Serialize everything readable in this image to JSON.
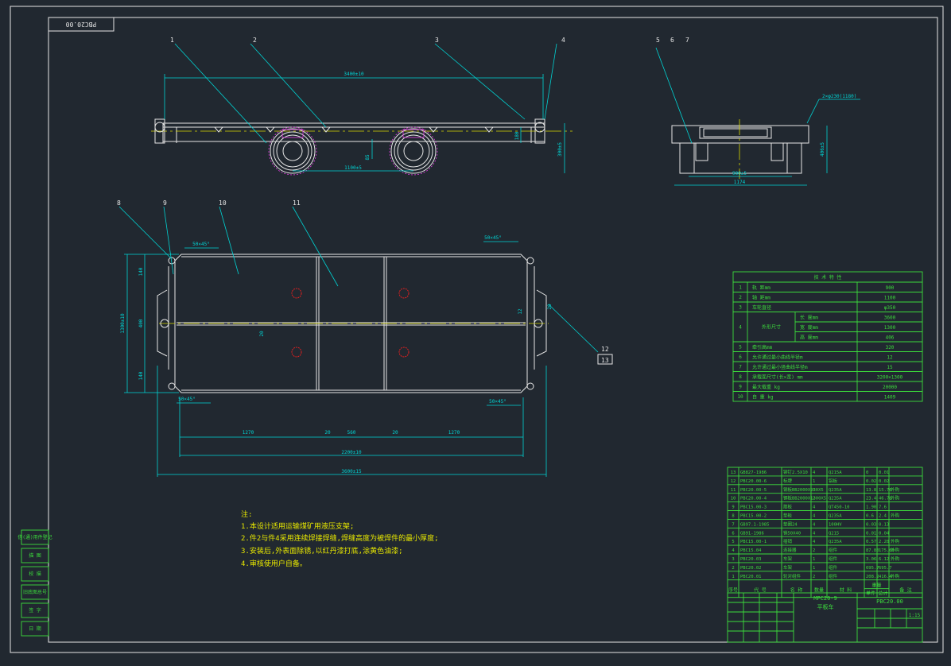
{
  "drawing_code_box": "PBC20.00",
  "balloons_top": [
    "1",
    "2",
    "3",
    "4"
  ],
  "balloons_side": [
    "5",
    "6",
    "7"
  ],
  "balloons_plan": [
    "8",
    "9",
    "10",
    "11"
  ],
  "balloons_right": [
    "12",
    "13"
  ],
  "dims": {
    "top_len": "3400±10",
    "wheelbase": "1100±5",
    "height": "300±5",
    "h_small": "180",
    "offset": "85",
    "side_note": "2×φ230(1180)",
    "side_height": "406±5",
    "side_gauge": "900±5",
    "side_width": "1174",
    "corner_tl": "50×45°",
    "corner_tr": "50×45°",
    "corner_bl": "50×45°",
    "corner_br": "50×45°",
    "plan_seg1": "1270",
    "plan_seg2": "20",
    "plan_seg3": "560",
    "plan_seg4": "20",
    "plan_seg5": "1270",
    "plan_inner": "2200±10",
    "plan_total": "3600±15",
    "plan_height": "1300±10",
    "plan_h1": "140",
    "plan_h2": "400",
    "plan_h3": "140",
    "plan_mid": "20",
    "plan_right_a": "12",
    "plan_right_b": "20"
  },
  "spec_table": {
    "title": "技 术 特 性",
    "rows": [
      {
        "no": "1",
        "label": "轨 距mm",
        "value": "900"
      },
      {
        "no": "2",
        "label": "轴 距mm",
        "value": "1100"
      },
      {
        "no": "3",
        "label": "车轮直径",
        "value": "φ350"
      },
      {
        "no": "4",
        "label": "外形尺寸",
        "sub": [
          {
            "label": "长 度mm",
            "value": "3600"
          },
          {
            "label": "宽 度mm",
            "value": "1300"
          },
          {
            "label": "高 度mm",
            "value": "406"
          }
        ]
      },
      {
        "no": "5",
        "label": "牵引高mm",
        "value": "320"
      },
      {
        "no": "6",
        "label": "允许通过最小曲线半径m",
        "value": "12"
      },
      {
        "no": "7",
        "label": "允许通过最小竖曲线半径m",
        "value": "15"
      },
      {
        "no": "8",
        "label": "承载面尺寸(长×宽) mm",
        "value": "3200×1300"
      },
      {
        "no": "9",
        "label": "最大载重 kg",
        "value": "20000"
      },
      {
        "no": "10",
        "label": "自 重 kg",
        "value": "1409"
      }
    ]
  },
  "bom": {
    "rows": [
      [
        "13",
        "GB827-1986",
        "铆钉2.5X10",
        "4",
        "Q215A",
        "0",
        "0.01",
        ""
      ],
      [
        "12",
        "PBC20.00-6",
        "标牌",
        "1",
        "铝板",
        "0.02",
        "0.02",
        ""
      ],
      [
        "11",
        "PBC20.00-5",
        "钢板BB2000X930X5",
        "1",
        "Q235A",
        "13.8",
        "15.76",
        "外购"
      ],
      [
        "10",
        "PBC20.00-4",
        "钢板BB2000X1300X5",
        "2",
        "Q235A",
        "23.4",
        "46.78",
        "外购"
      ],
      [
        "9",
        "PBC15.00-3",
        "筋板",
        "4",
        "QT450-10",
        "1.90",
        "7.6",
        ""
      ],
      [
        "8",
        "PBC15.00-2",
        "垫板",
        "4",
        "Q235A",
        "0.6",
        "2.4",
        "外购"
      ],
      [
        "7",
        "GB97.1-1985",
        "垫圈24",
        "4",
        "100HV",
        "0.03",
        "0.13",
        ""
      ],
      [
        "6",
        "GB91-1986",
        "销50X40",
        "4",
        "Q215",
        "0.01",
        "0.04",
        ""
      ],
      [
        "5",
        "PBC15.00-1",
        "插销",
        "4",
        "Q235A",
        "0.57",
        "2.28",
        "外购"
      ],
      [
        "4",
        "PBC15.04",
        "连接器",
        "2",
        "组件",
        "87.80",
        "175.60",
        "外购"
      ],
      [
        "3",
        "PBC20.03",
        "车架",
        "1",
        "组件",
        "3.06",
        "6.12",
        "外购"
      ],
      [
        "2",
        "PBC20.02",
        "车架",
        "1",
        "组件",
        "695.7",
        "695.7",
        ""
      ],
      [
        "1",
        "PBC20.01",
        "轮对组件",
        "2",
        "组件",
        "208.2",
        "416.4",
        "外购"
      ]
    ],
    "header": [
      "序号",
      "代 号",
      "名 称",
      "数量",
      "材 料",
      "单件",
      "总计",
      "备 注"
    ],
    "header_sub": "重量"
  },
  "title_block": {
    "model": "MPC20-9",
    "name": "平板车",
    "code": "PBC20.00",
    "scale_label": "1:15"
  },
  "notes": {
    "heading": "注:",
    "lines": [
      "1.本设计适用运输煤矿用液压支架;",
      "2.件2与件4采用连续焊接焊缝,焊缝高度为被焊件的最小厚度;",
      "3.安装后,外表面除锈,以红丹漆打底,涂黄色油漆;",
      "4.审核使用户自备。"
    ]
  },
  "left_strip": [
    "借(通)用件登记",
    "描 图",
    "校 描",
    "旧底图总号",
    "签 字",
    "日 期"
  ]
}
